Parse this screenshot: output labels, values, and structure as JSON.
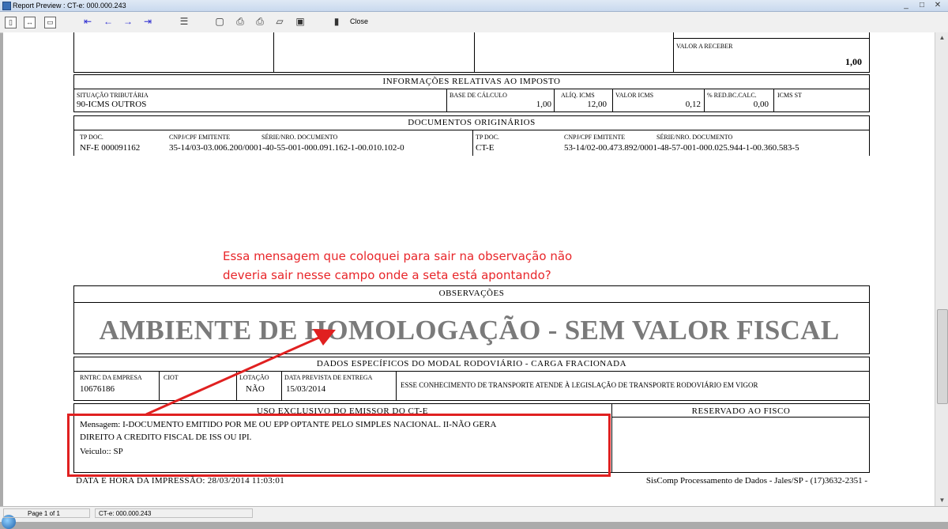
{
  "window": {
    "title": "Report Preview : CT-e: 000.000.243",
    "controls": [
      "_",
      "□",
      "✕"
    ]
  },
  "toolbar": {
    "close_label": "Close"
  },
  "status": {
    "page": "Page 1 of 1",
    "doc": "CT-e: 000.000.243"
  },
  "report": {
    "valor_receber_label": "VALOR A RECEBER",
    "valor_receber_value": "1,00",
    "imposto": {
      "header": "INFORMAÇÕES RELATIVAS AO IMPOSTO",
      "situacao_label": "SITUAÇÃO TRIBUTÁRIA",
      "situacao_value": "90-ICMS OUTROS",
      "base_label": "BASE DE CÁLCULO",
      "base_value": "1,00",
      "aliq_label": "ALÍQ. ICMS",
      "aliq_value": "12,00",
      "valor_icms_label": "VALOR ICMS",
      "valor_icms_value": "0,12",
      "red_label": "% RED.BC.CALC.",
      "red_value": "0,00",
      "icms_st_label": "ICMS ST"
    },
    "documentos": {
      "header": "DOCUMENTOS ORIGINÁRIOS",
      "left": {
        "tp_label": "TP DOC.",
        "cnpj_label": "CNPJ/CPF EMITENTE",
        "serie_label": "SÉRIE/NRO. DOCUMENTO",
        "tp_value": "NF-E 000091162",
        "cnpj_serie_value": "35-14/03-03.006.200/0001-40-55-001-000.091.162-1-00.010.102-0"
      },
      "right": {
        "tp_label": "TP DOC.",
        "cnpj_label": "CNPJ/CPF EMITENTE",
        "serie_label": "SÉRIE/NRO. DOCUMENTO",
        "tp_value": "CT-E",
        "cnpj_serie_value": "53-14/02-00.473.892/0001-48-57-001-000.025.944-1-00.360.583-5"
      }
    },
    "annotation": {
      "line1": "Essa mensagem que coloquei para sair na observação não",
      "line2": "deveria sair nesse campo onde a seta está apontando?"
    },
    "observacoes": {
      "header": "OBSERVAÇÕES",
      "watermark": "AMBIENTE DE HOMOLOGAÇÃO - SEM VALOR FISCAL"
    },
    "modal": {
      "header": "DADOS ESPECÍFICOS DO MODAL RODOVIÁRIO - CARGA FRACIONADA",
      "rntrc_label": "RNTRC DA EMPRESA",
      "rntrc_value": "10676186",
      "ciot_label": "CIOT",
      "lotacao_label": "LOTAÇÃO",
      "lotacao_value": "NÃO",
      "data_label": "DATA PREVISTA DE ENTREGA",
      "data_value": "15/03/2014",
      "legislacao_text": "ESSE CONHECIMENTO DE TRANSPORTE ATENDE À LEGISLAÇÃO DE TRANSPORTE RODOVIÁRIO EM VIGOR"
    },
    "emissor": {
      "header": "USO EXCLUSIVO DO EMISSOR DO CT-E",
      "mensagem_line1": "Mensagem: I-DOCUMENTO EMITIDO POR ME OU EPP OPTANTE PELO SIMPLES NACIONAL. II-NÃO GERA",
      "mensagem_line2": "DIREITO A CREDITO FISCAL DE ISS OU IPI.",
      "veiculo": "Veiculo:: SP"
    },
    "fisco": {
      "header": "RESERVADO AO FISCO"
    },
    "footer": {
      "impressao": "DATA E HORA DA IMPRESSÃO:  28/03/2014 11:03:01",
      "empresa": "SisComp Processamento de Dados - Jales/SP - (17)3632-2351 -"
    }
  }
}
